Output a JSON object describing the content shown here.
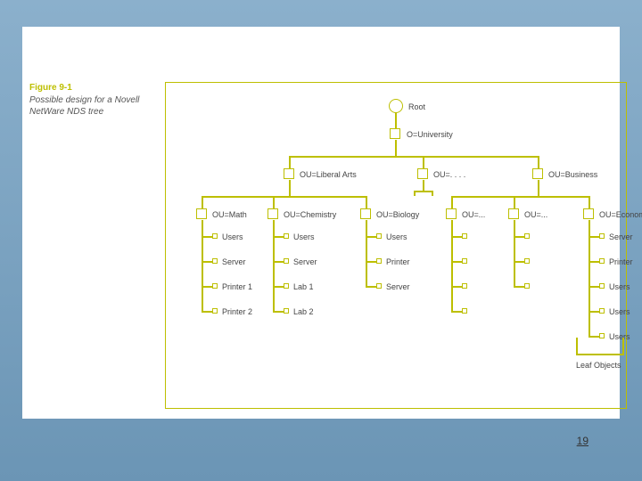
{
  "figure": {
    "number": "Figure 9-1",
    "title": "Possible design for a Novell NetWare NDS tree"
  },
  "tree": {
    "root": "Root",
    "org": "O=University",
    "ou_liberal_arts": "OU=Liberal Arts",
    "ou_ellipsis": "OU=. . . .",
    "ou_business": "OU=Business",
    "la_math": "OU=Math",
    "la_chem": "OU=Chemistry",
    "la_bio": "OU=Biology",
    "bus_a": "OU=...",
    "bus_b": "OU=...",
    "bus_econ": "OU=Economics",
    "math_items": [
      "Users",
      "Server",
      "Printer 1",
      "Printer 2"
    ],
    "chem_items": [
      "Users",
      "Server",
      "Lab 1",
      "Lab 2"
    ],
    "bio_items": [
      "Users",
      "Printer",
      "Server"
    ],
    "econ_items": [
      "Server",
      "Printer",
      "Users",
      "Users",
      "Users"
    ],
    "leaf_objects": "Leaf Objects"
  },
  "page_number": "19"
}
